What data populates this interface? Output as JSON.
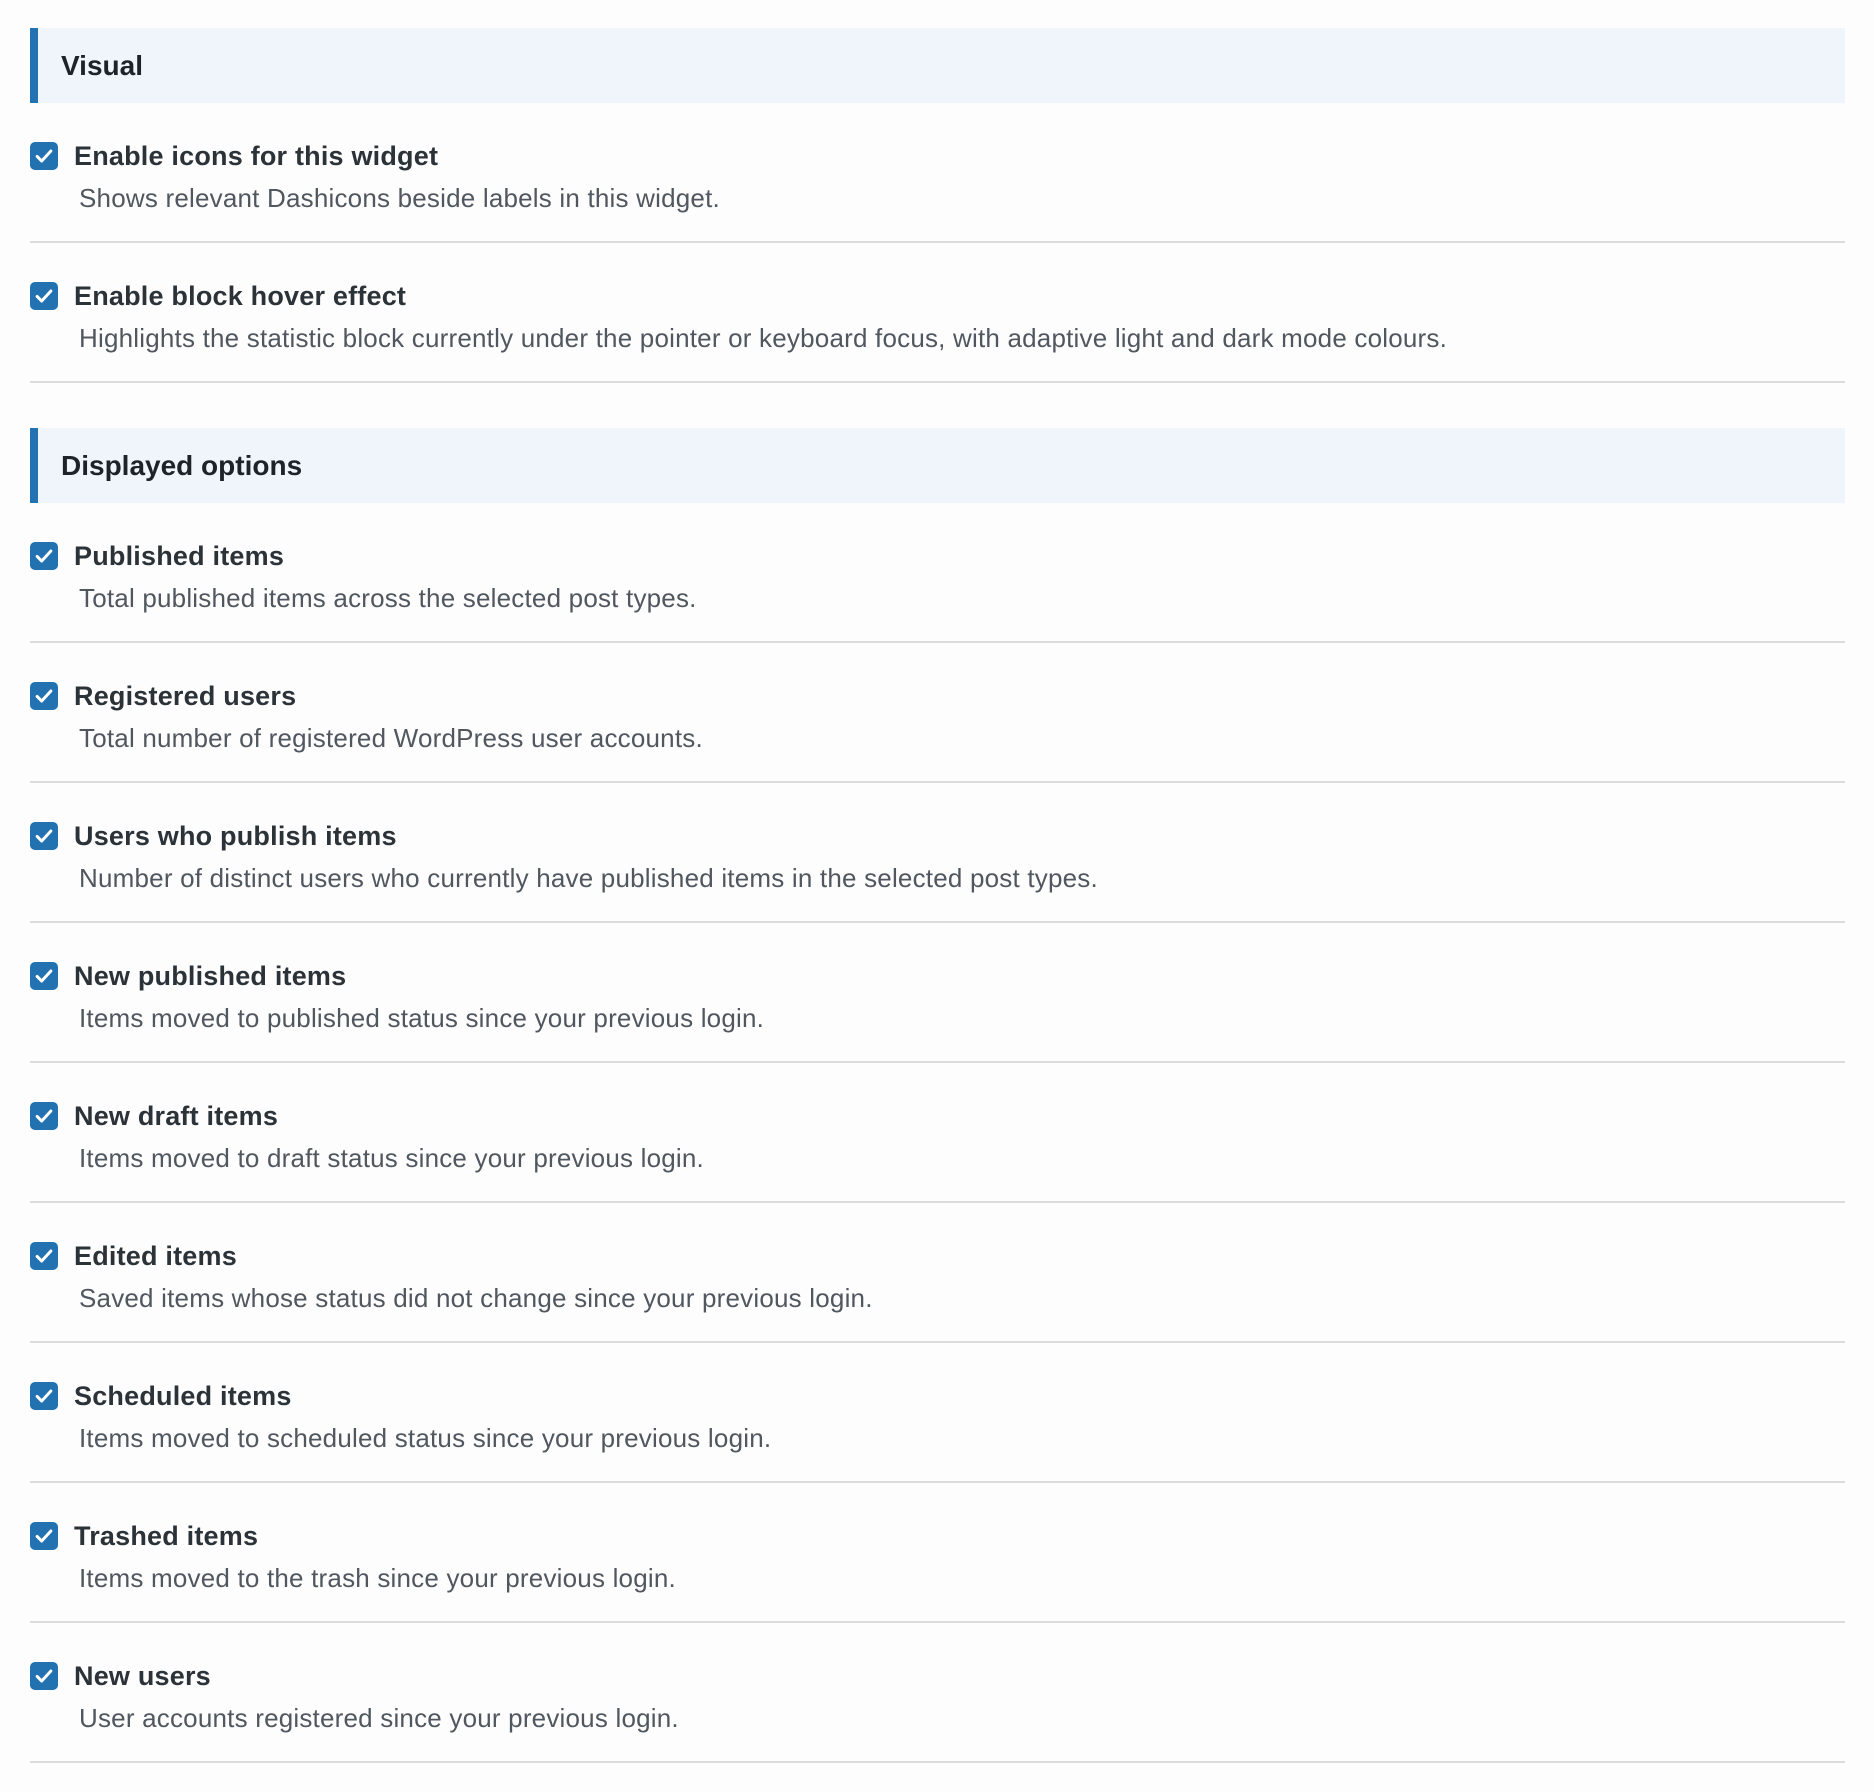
{
  "sections": [
    {
      "title": "Visual",
      "options": [
        {
          "label": "Enable icons for this widget",
          "description": "Shows relevant Dashicons beside labels in this widget.",
          "checked": true
        },
        {
          "label": "Enable block hover effect",
          "description": "Highlights the statistic block currently under the pointer or keyboard focus, with adaptive light and dark mode colours.",
          "checked": true
        }
      ]
    },
    {
      "title": "Displayed options",
      "options": [
        {
          "label": "Published items",
          "description": "Total published items across the selected post types.",
          "checked": true
        },
        {
          "label": "Registered users",
          "description": "Total number of registered WordPress user accounts.",
          "checked": true
        },
        {
          "label": "Users who publish items",
          "description": "Number of distinct users who currently have published items in the selected post types.",
          "checked": true
        },
        {
          "label": "New published items",
          "description": "Items moved to published status since your previous login.",
          "checked": true
        },
        {
          "label": "New draft items",
          "description": "Items moved to draft status since your previous login.",
          "checked": true
        },
        {
          "label": "Edited items",
          "description": "Saved items whose status did not change since your previous login.",
          "checked": true
        },
        {
          "label": "Scheduled items",
          "description": "Items moved to scheduled status since your previous login.",
          "checked": true
        },
        {
          "label": "Trashed items",
          "description": "Items moved to the trash since your previous login.",
          "checked": true
        },
        {
          "label": "New users",
          "description": "User accounts registered since your previous login.",
          "checked": true
        }
      ]
    }
  ],
  "colors": {
    "accent": "#2271b1",
    "header_bg": "#f0f4fb",
    "divider": "#dcdcde"
  },
  "icons": {
    "checkbox": "checkmark-icon"
  }
}
